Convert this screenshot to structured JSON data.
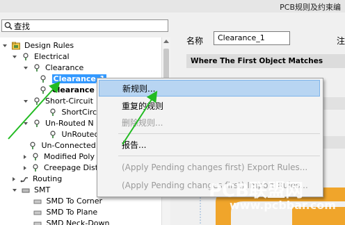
{
  "window": {
    "title": "PCB规则及约束编"
  },
  "search": {
    "value": "查找"
  },
  "tree": {
    "items": [
      {
        "label": "Design Rules"
      },
      {
        "label": "Electrical"
      },
      {
        "label": "Clearance"
      },
      {
        "label": "Clearance_1"
      },
      {
        "label": "Clearance"
      },
      {
        "label": "Short-Circuit"
      },
      {
        "label": "ShortCircuit"
      },
      {
        "label": "Un-Routed N"
      },
      {
        "label": "UnRouted"
      },
      {
        "label": "Un-Connected"
      },
      {
        "label": "Modified Poly"
      },
      {
        "label": "Creepage Dist"
      },
      {
        "label": "Routing"
      },
      {
        "label": "SMT"
      },
      {
        "label": "SMD To Corner"
      },
      {
        "label": "SMD To Plane"
      },
      {
        "label": "SMD Neck-Down"
      }
    ]
  },
  "rule": {
    "name_label": "名称",
    "name_value": "Clearance_1",
    "extra_label": "注",
    "where_first": "Where The First Object Matches"
  },
  "context_menu": {
    "items": [
      {
        "label": "新规则...",
        "enabled": true,
        "highlighted": true
      },
      {
        "label": "重复的规则",
        "enabled": true
      },
      {
        "label": "删除规则...",
        "enabled": false
      },
      {
        "label": "报告...",
        "enabled": true
      },
      {
        "label": "(Apply Pending changes first) Export Rules...",
        "enabled": false
      },
      {
        "label": "(Apply Pending changes first) Import Rules...",
        "enabled": false
      }
    ]
  },
  "watermark": {
    "line1": "PCB联盟网",
    "line2": "www.pcbbar.com"
  },
  "colors": {
    "selection": "#3399ff",
    "menu_highlight": "#b8d5f2",
    "arrow": "#22bb22"
  }
}
